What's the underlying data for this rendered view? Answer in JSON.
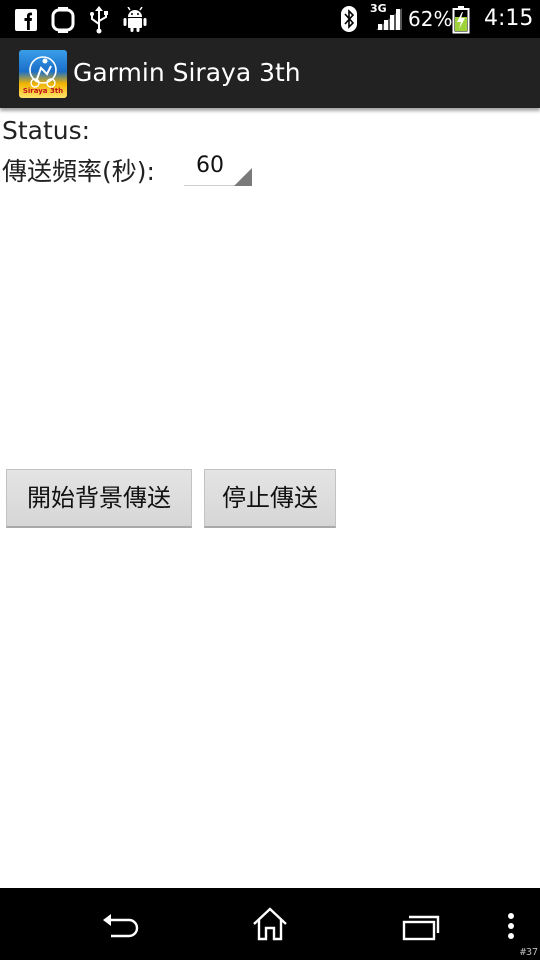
{
  "status_bar": {
    "left_icons": [
      "facebook-icon",
      "sync-icon",
      "usb-icon",
      "android-debug-icon"
    ],
    "right_icons": [
      "bluetooth-icon",
      "signal-3g-icon",
      "battery-charging-icon"
    ],
    "network_type": "3G",
    "battery_percent": "62%",
    "time": "4:15"
  },
  "action_bar": {
    "title": "Garmin Siraya 3th",
    "app_icon": "garmin-siraya-app-icon",
    "icon_text": "Siraya 3th"
  },
  "main": {
    "status_label": "Status:",
    "frequency_label": "傳送頻率(秒):",
    "frequency_value": "60",
    "start_button": "開始背景傳送",
    "stop_button": "停止傳送"
  },
  "nav_bar": {
    "icons": [
      "back-icon",
      "home-icon",
      "recent-apps-icon",
      "overflow-menu-icon"
    ]
  },
  "screenshot_tag": "#37",
  "colors": {
    "status_bar_bg": "#000000",
    "action_bar_bg": "#222222",
    "content_bg": "#ffffff",
    "button_bg": "#dcdcdc"
  }
}
